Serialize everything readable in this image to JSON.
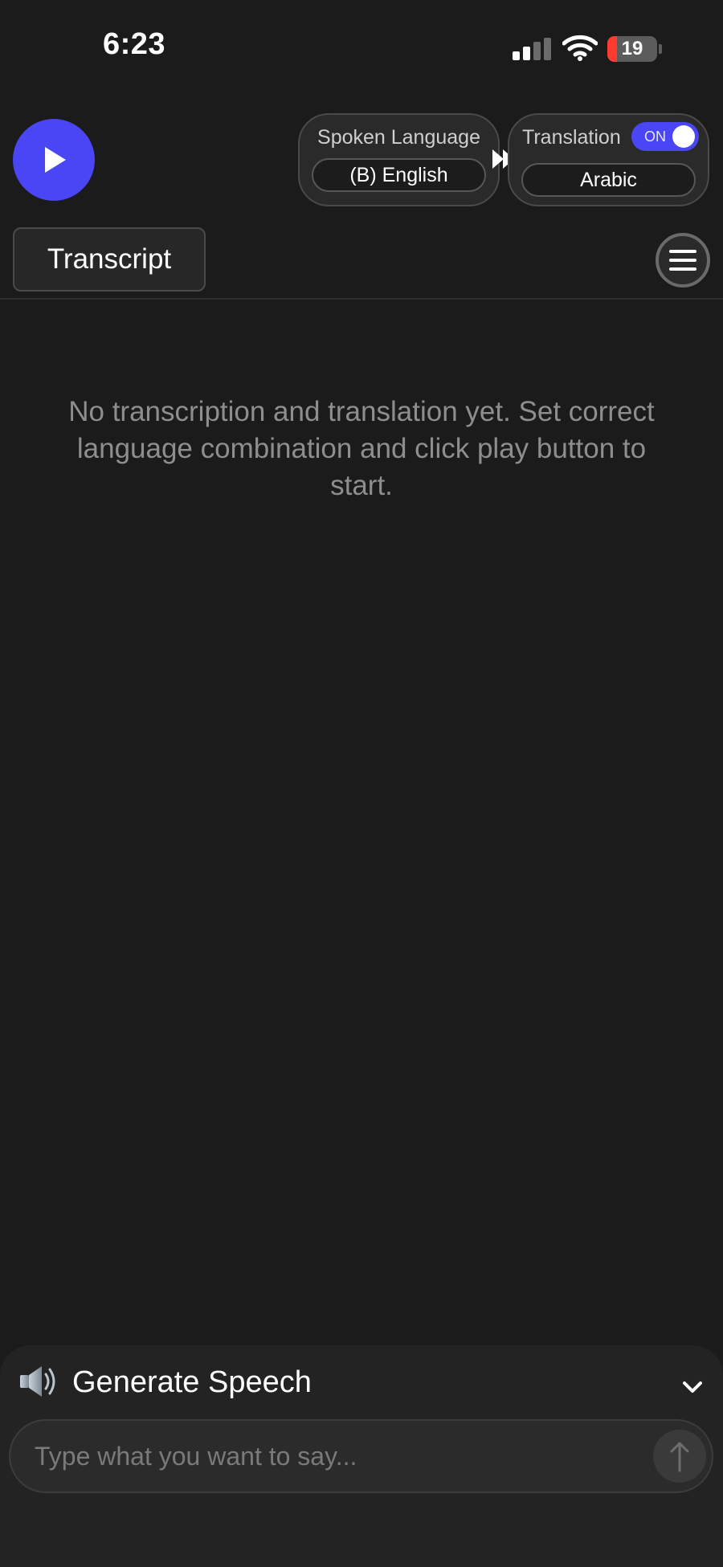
{
  "status_bar": {
    "time": "6:23",
    "battery_level": "19",
    "battery_color": "#ff3b30"
  },
  "header": {
    "play_button_icon": "play-icon",
    "spoken_language": {
      "label": "Spoken Language",
      "value": "(B) English"
    },
    "arrow_icon": "double-arrow-right-icon",
    "translation": {
      "label": "Translation",
      "toggle_state": "ON",
      "value": "Arabic"
    }
  },
  "tabs": {
    "active": "Transcript"
  },
  "menu_icon": "hamburger-menu-icon",
  "transcript": {
    "empty_message": "No transcription and translation yet. Set correct language combination and click play button to start."
  },
  "generate_speech": {
    "icon": "speaker-icon",
    "title": "Generate Speech",
    "collapse_icon": "chevron-down-icon",
    "input_placeholder": "Type what you want to say...",
    "send_icon": "arrow-up-icon"
  },
  "colors": {
    "accent": "#4a45f5",
    "background": "#1b1b1b"
  }
}
